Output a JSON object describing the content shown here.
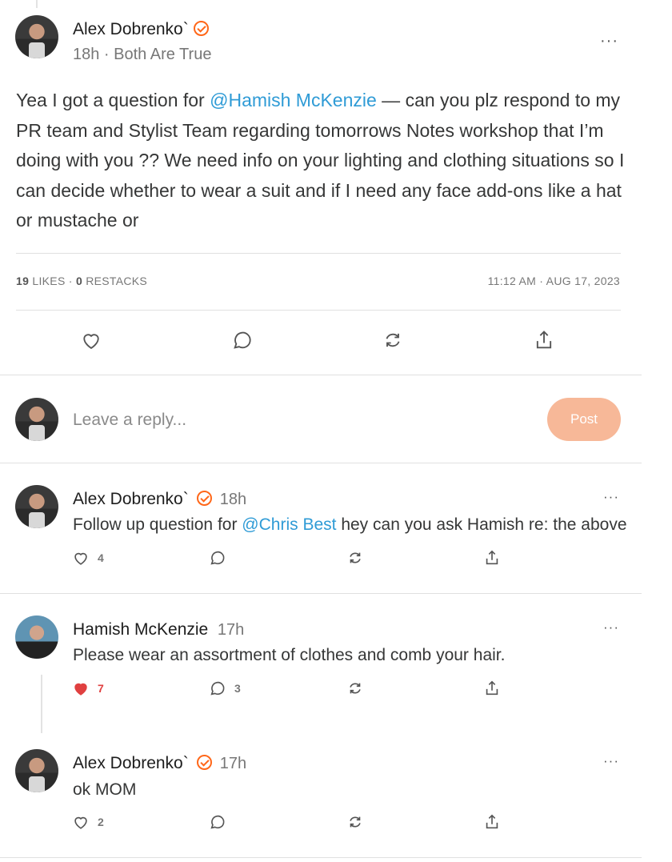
{
  "post": {
    "author": "Alex Dobrenko`",
    "meta": "18h · Both Are True",
    "body_parts": {
      "before": "Yea I got a question for ",
      "mention": "@Hamish McKenzie",
      "after": " — can you plz respond to my PR team and Stylist Team regarding tomorrows Notes workshop that I’m doing with you ?? We need info on your lighting and clothing situations so I can decide whether to wear a suit and if I need any face add-ons like a hat or mustache or"
    },
    "likes_count": "19",
    "likes_label": "LIKES",
    "restacks_count": "0",
    "restacks_label": "RESTACKS",
    "timestamp": "11:12 AM · AUG 17, 2023",
    "more": "···"
  },
  "reply_box": {
    "placeholder": "Leave a reply...",
    "post_label": "Post"
  },
  "comments": [
    {
      "author": "Alex Dobrenko`",
      "verified": true,
      "time": "18h",
      "text_before": "Follow up question for ",
      "mention": "@Chris Best",
      "text_after": " hey can you ask Hamish re: the above",
      "likes": "4",
      "replies": "",
      "liked": false
    },
    {
      "author": "Hamish McKenzie",
      "verified": false,
      "time": "17h",
      "text": "Please wear an assortment of clothes and comb your hair.",
      "likes": "7",
      "replies": "3",
      "liked": true
    },
    {
      "author": "Alex Dobrenko`",
      "verified": true,
      "time": "17h",
      "text": "ok MOM",
      "likes": "2",
      "replies": "",
      "liked": false
    }
  ],
  "more": "···",
  "colors": {
    "accent": "#ff6719",
    "mention": "#2f9bd6",
    "liked": "#e04040",
    "post_button": "#f7b898"
  }
}
